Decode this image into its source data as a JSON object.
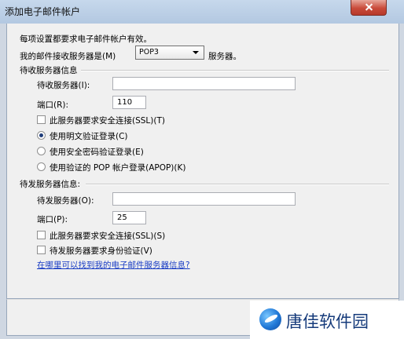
{
  "window": {
    "title": "添加电子邮件帐户"
  },
  "dialog": {
    "intro": "每项设置都要求电子邮件帐户有效。",
    "server_type_label": "我的邮件接收服务器是(M)",
    "server_type_value": "POP3",
    "server_type_suffix": "服务器。",
    "incoming": {
      "section_title": "待收服务器信息",
      "server_label": "待收服务器(I):",
      "server_value": "",
      "port_label": "端口(R):",
      "port_value": "110",
      "ssl_label": "此服务器要求安全连接(SSL)(T)",
      "auth_options": [
        "使用明文验证登录(C)",
        "使用安全密码验证登录(E)",
        "使用验证的 POP 帐户登录(APOP)(K)"
      ],
      "selected_auth_index": 0
    },
    "outgoing": {
      "section_title": "待发服务器信息:",
      "server_label": "待发服务器(O):",
      "server_value": "",
      "port_label": "端口(P):",
      "port_value": "25",
      "ssl_label": "此服务器要求安全连接(SSL)(S)",
      "auth_label": "待发服务器要求身份验证(V)"
    },
    "help_link": "在哪里可以找到我的电子邮件服务器信息?"
  },
  "watermark": {
    "text": "唐佳软件园"
  }
}
